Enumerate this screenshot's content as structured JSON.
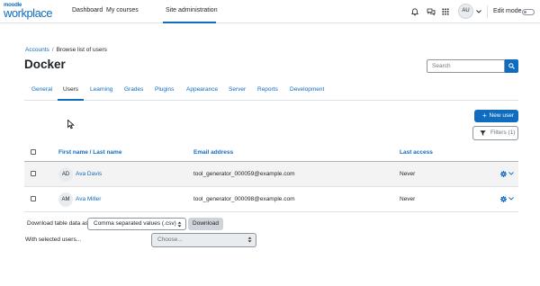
{
  "brand": {
    "top": "moodle",
    "bottom": "workplace"
  },
  "nav": {
    "links": [
      "Dashboard",
      "My courses",
      "Site administration"
    ],
    "active_index": 2,
    "icons": [
      "bell-icon",
      "chat-icon",
      "grid-icon"
    ],
    "user_initials": "AU",
    "edit_mode_label": "Edit mode"
  },
  "breadcrumb": {
    "items": [
      "Accounts",
      "Browse list of users"
    ]
  },
  "page": {
    "title": "Docker"
  },
  "search": {
    "placeholder": "Search"
  },
  "tabs": [
    "General",
    "Users",
    "Learning",
    "Grades",
    "Plugins",
    "Appearance",
    "Server",
    "Reports",
    "Development"
  ],
  "active_tab": "Users",
  "actions": {
    "new_user": "New user",
    "filters": "Filters (1)"
  },
  "table": {
    "columns": [
      "First name / Last name",
      "Email address",
      "Last access"
    ],
    "rows": [
      {
        "initials": "AD",
        "name": "Ava Davis",
        "email": "tool_generator_000059@example.com",
        "last_access": "Never"
      },
      {
        "initials": "AM",
        "name": "Ava Miller",
        "email": "tool_generator_000098@example.com",
        "last_access": "Never"
      }
    ]
  },
  "download": {
    "label": "Download table data as",
    "format": "Comma separated values (.csv)",
    "button": "Download"
  },
  "bulk": {
    "label": "With selected users...",
    "placeholder": "Choose..."
  },
  "colors": {
    "accent": "#0f6cbf",
    "text": "#1d2125",
    "muted": "#6a737b",
    "border": "#dee2e6",
    "row_highlight": "#f3f3f3"
  }
}
